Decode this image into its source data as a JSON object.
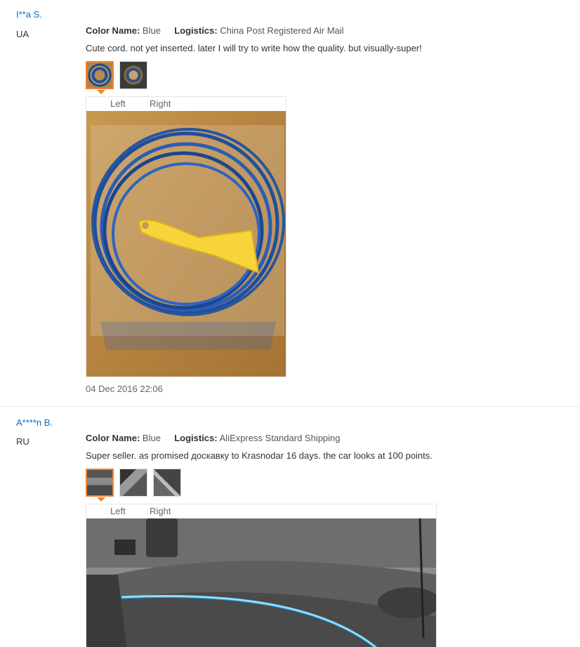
{
  "reviews": [
    {
      "user": "I**a S.",
      "country": "UA",
      "color_label": "Color Name:",
      "color_value": "Blue",
      "logistics_label": "Logistics:",
      "logistics_value": "China Post Registered Air Mail",
      "text": "Cute cord. not yet inserted. later I will try to write how the quality. but visually-super!",
      "viewer_left": "Left",
      "viewer_right": "Right",
      "date": "04 Dec 2016 22:06"
    },
    {
      "user": "A****n B.",
      "country": "RU",
      "color_label": "Color Name:",
      "color_value": "Blue",
      "logistics_label": "Logistics:",
      "logistics_value": "AliExpress Standard Shipping",
      "text": "Super seller. as promised доскавку to Krasnodar 16 days. the car looks at 100 points.",
      "viewer_left": "Left",
      "viewer_right": "Right"
    }
  ],
  "colors": {
    "link": "#0a6cc6",
    "active_thumb": "#f5822a",
    "divider": "#e8e8e8"
  }
}
